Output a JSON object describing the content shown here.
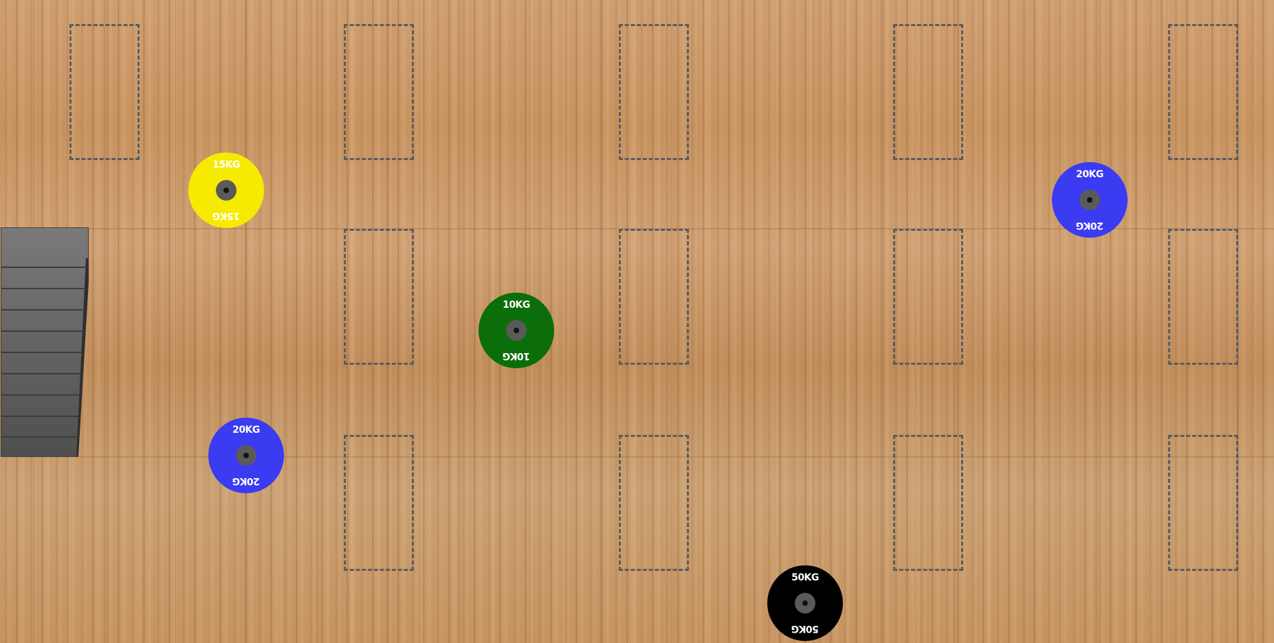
{
  "scene": {
    "floor": "wood-floor"
  },
  "colors": {
    "yellow_plate": "#f6ea00",
    "blue_plate": "#3b3bf2",
    "green_plate": "#0b6e0b",
    "black_plate": "#000000",
    "slot_border": "#5c5c5c",
    "rack": "#6a6a6a"
  },
  "plates": [
    {
      "id": "plate-15kg",
      "label": "15KG",
      "color": "#f6ea00"
    },
    {
      "id": "plate-20kg-right",
      "label": "20KG",
      "color": "#3b3bf2"
    },
    {
      "id": "plate-10kg",
      "label": "10KG",
      "color": "#0b6e0b"
    },
    {
      "id": "plate-20kg-left",
      "label": "20KG",
      "color": "#3b3bf2"
    },
    {
      "id": "plate-50kg",
      "label": "50KG",
      "color": "#000000"
    }
  ],
  "rack": {
    "icon": "plate-rack",
    "shelves": 9
  }
}
